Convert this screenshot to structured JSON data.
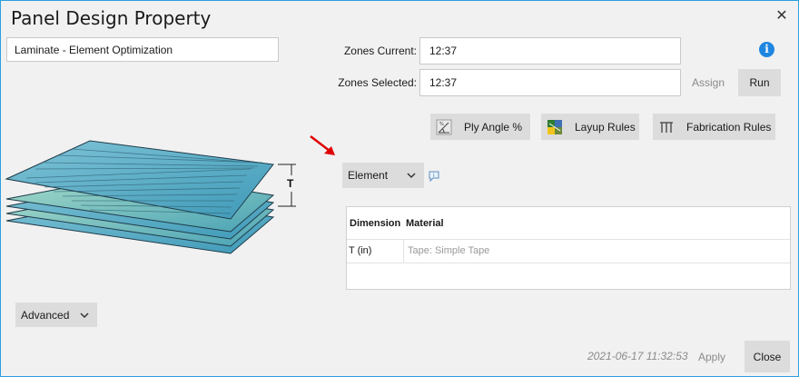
{
  "window": {
    "title": "Panel Design Property"
  },
  "name_field": {
    "value": "Laminate - Element Optimization"
  },
  "zones_current": {
    "label": "Zones Current:",
    "value": "12:37"
  },
  "zones_selected": {
    "label": "Zones Selected:",
    "value": "12:37"
  },
  "actions": {
    "assign_label": "Assign",
    "run_label": "Run"
  },
  "toolbar": {
    "ply_angle_label": "Ply Angle %",
    "layup_rules_label": "Layup Rules",
    "fabrication_rules_label": "Fabrication Rules"
  },
  "illustration": {
    "thickness_label": "T"
  },
  "element_dropdown": {
    "selected": "Element"
  },
  "table": {
    "columns": [
      "Dimension",
      "Material"
    ],
    "rows": [
      {
        "dimension": "T (in)",
        "material_placeholder": "Tape: Simple Tape"
      }
    ]
  },
  "advanced_dropdown": {
    "label": "Advanced"
  },
  "footer": {
    "timestamp": "2021-06-17 11:32:53",
    "apply_label": "Apply",
    "close_label": "Close"
  },
  "colors": {
    "accent_blue": "#1f86e0",
    "dialog_bg": "#f1f1f1",
    "button_bg": "#dcdcdc",
    "arrow_red": "#e00000",
    "laminate_teal": "#5fb3cc"
  },
  "icons": [
    "close-icon",
    "info-icon",
    "ply-angle-icon",
    "layup-rules-icon",
    "fabrication-rules-icon",
    "chevron-down-icon",
    "tooltip-info-icon",
    "red-arrow-annotation"
  ]
}
